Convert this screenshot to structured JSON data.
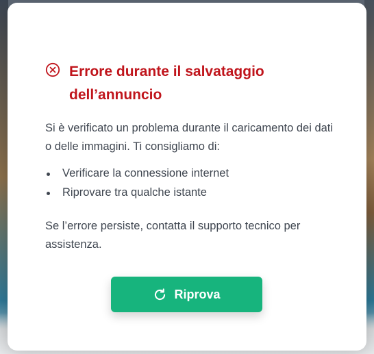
{
  "dialog": {
    "title": "Errore durante il salvataggio dell’annuncio",
    "icon": "error-circle-x-icon",
    "message": "Si è verificato un problema durante il caricamento dei dati o delle immagini. Ti consigliamo di:",
    "suggestions": [
      "Verificare la connessione internet",
      "Riprovare tra qualche istante"
    ],
    "footer": "Se l’errore persiste, contatta il supporto tecnico per assistenza.",
    "retry_button": {
      "label": "Riprova",
      "icon": "refresh-icon"
    }
  },
  "colors": {
    "error": "#c0151c",
    "button": "#17b47d",
    "text": "#3f4650"
  }
}
